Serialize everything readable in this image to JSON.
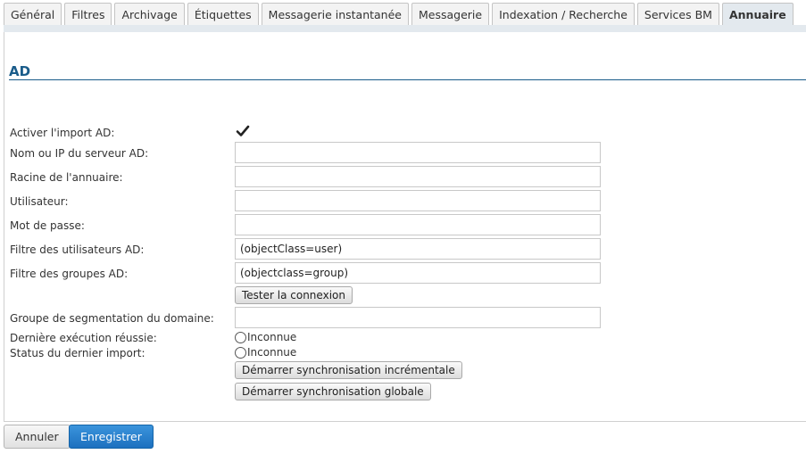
{
  "tabs": [
    {
      "label": "Général"
    },
    {
      "label": "Filtres"
    },
    {
      "label": "Archivage"
    },
    {
      "label": "Étiquettes"
    },
    {
      "label": "Messagerie instantanée"
    },
    {
      "label": "Messagerie"
    },
    {
      "label": "Indexation / Recherche"
    },
    {
      "label": "Services BM"
    },
    {
      "label": "Annuaire"
    }
  ],
  "active_tab": "Annuaire",
  "section": {
    "title": "AD"
  },
  "form": {
    "enable_import_label": "Activer l'import AD:",
    "enable_import_checked": true,
    "server_label": "Nom ou IP du serveur AD:",
    "server_value": "",
    "root_label": "Racine de l'annuaire:",
    "root_value": "",
    "user_label": "Utilisateur:",
    "user_value": "",
    "password_label": "Mot de passe:",
    "password_value": "",
    "user_filter_label": "Filtre des utilisateurs AD:",
    "user_filter_value": "(objectClass=user)",
    "group_filter_label": "Filtre des groupes AD:",
    "group_filter_value": "(objectclass=group)",
    "test_button": "Tester la connexion",
    "segmentation_label": "Groupe de segmentation du domaine:",
    "segmentation_value": "",
    "last_run_label": "Dernière exécution réussie:",
    "last_run_value": "Inconnue",
    "last_status_label": "Status du dernier import:",
    "last_status_value": "Inconnue",
    "incremental_button": "Démarrer synchronisation incrémentale",
    "global_button": "Démarrer synchronisation globale"
  },
  "footer": {
    "cancel": "Annuler",
    "save": "Enregistrer"
  },
  "colors": {
    "accent": "#1a5c8a",
    "primary_button": "#1c70bf"
  }
}
